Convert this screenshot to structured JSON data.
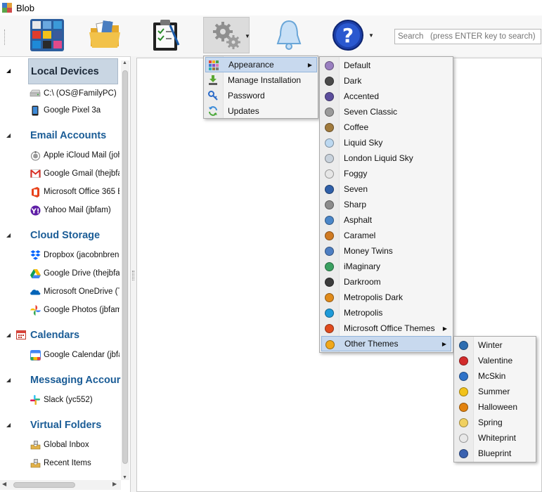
{
  "window": {
    "title": "Blob"
  },
  "search": {
    "placeholder": "Search   (press ENTER key to search)"
  },
  "toolbar": {
    "buttons": [
      {
        "name": "accounts",
        "icon": "app-grid-icon"
      },
      {
        "name": "folders",
        "icon": "folder-icon"
      },
      {
        "name": "tasks",
        "icon": "clipboard-checklist-icon"
      },
      {
        "name": "settings",
        "icon": "gears-icon"
      },
      {
        "name": "notifications",
        "icon": "bell-icon"
      },
      {
        "name": "help",
        "icon": "help-icon"
      }
    ]
  },
  "sidebar": {
    "sections": [
      {
        "label": "Local Devices",
        "items": [
          {
            "label": "C:\\ (OS@FamilyPC)",
            "icon": "drive-icon"
          },
          {
            "label": "Google Pixel 3a",
            "icon": "phone-icon"
          }
        ]
      },
      {
        "label": "Email Accounts",
        "items": [
          {
            "label": "Apple iCloud Mail (john",
            "icon": "apple-icon"
          },
          {
            "label": "Google Gmail (thejbfan",
            "icon": "gmail-icon"
          },
          {
            "label": "Microsoft Office 365 E",
            "icon": "office-icon"
          },
          {
            "label": "Yahoo Mail (jbfam)",
            "icon": "yahoo-icon"
          }
        ]
      },
      {
        "label": "Cloud Storage",
        "items": [
          {
            "label": "Dropbox (jacobnbrend",
            "icon": "dropbox-icon"
          },
          {
            "label": "Google Drive (thejbfan",
            "icon": "google-drive-icon"
          },
          {
            "label": "Microsoft OneDrive (Te",
            "icon": "onedrive-icon"
          },
          {
            "label": "Google Photos (jbfam(",
            "icon": "google-photos-icon"
          }
        ]
      },
      {
        "label": "Calendars",
        "items": [
          {
            "label": "Google Calendar (jbfan",
            "icon": "google-calendar-icon"
          }
        ]
      },
      {
        "label": "Messaging Accour",
        "items": [
          {
            "label": "Slack (yc552)",
            "icon": "slack-icon"
          }
        ]
      },
      {
        "label": "Virtual Folders",
        "items": [
          {
            "label": "Global Inbox",
            "icon": "inbox-icon"
          },
          {
            "label": "Recent Items",
            "icon": "recent-icon"
          }
        ]
      }
    ]
  },
  "settings_menu": {
    "items": [
      {
        "label": "Appearance",
        "icon": "palette-icon",
        "has_submenu": true
      },
      {
        "label": "Manage Installation",
        "icon": "install-icon"
      },
      {
        "label": "Password",
        "icon": "key-icon"
      },
      {
        "label": "Updates",
        "icon": "refresh-icon"
      }
    ]
  },
  "appearance_menu": {
    "items": [
      {
        "label": "Default",
        "color": "#9a7fc0"
      },
      {
        "label": "Dark",
        "color": "#4a4a4a"
      },
      {
        "label": "Accented",
        "color": "#5b4d9c"
      },
      {
        "label": "Seven Classic",
        "color": "#9a9a9a"
      },
      {
        "label": "Coffee",
        "color": "#a07a3c"
      },
      {
        "label": "Liquid Sky",
        "color": "#bcd8f0"
      },
      {
        "label": "London Liquid Sky",
        "color": "#c8d2dc"
      },
      {
        "label": "Foggy",
        "color": "#e6e6e6"
      },
      {
        "label": "Seven",
        "color": "#2f5fa8"
      },
      {
        "label": "Sharp",
        "color": "#8c8c8c"
      },
      {
        "label": "Asphalt",
        "color": "#4a86c8"
      },
      {
        "label": "Caramel",
        "color": "#d07a22"
      },
      {
        "label": "Money Twins",
        "color": "#4d7ec2"
      },
      {
        "label": "iMaginary",
        "color": "#3aa060"
      },
      {
        "label": "Darkroom",
        "color": "#3a3a3a"
      },
      {
        "label": "Metropolis Dark",
        "color": "#e08a1a"
      },
      {
        "label": "Metropolis",
        "color": "#1e9ad8"
      },
      {
        "label": "Microsoft Office Themes",
        "color": "#e04a1c",
        "has_submenu": true
      },
      {
        "label": "Other Themes",
        "color": "#f0a81c",
        "has_submenu": true
      }
    ]
  },
  "other_themes_menu": {
    "items": [
      {
        "label": "Winter",
        "color": "#2e6db0"
      },
      {
        "label": "Valentine",
        "color": "#d22a2a"
      },
      {
        "label": "McSkin",
        "color": "#2e72c8"
      },
      {
        "label": "Summer",
        "color": "#f2c21a"
      },
      {
        "label": "Halloween",
        "color": "#e2820e"
      },
      {
        "label": "Spring",
        "color": "#f0d060"
      },
      {
        "label": "Whiteprint",
        "color": "#e8e8e8"
      },
      {
        "label": "Blueprint",
        "color": "#3a62b0"
      }
    ]
  }
}
